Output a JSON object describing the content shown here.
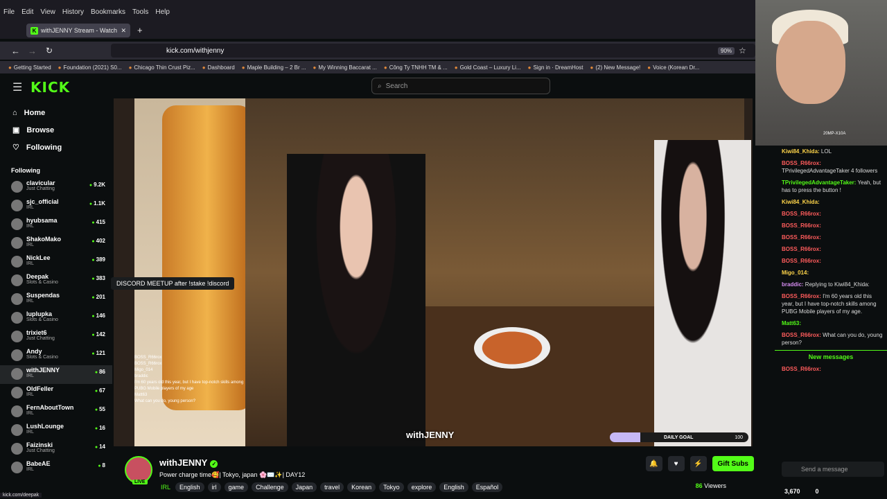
{
  "browser": {
    "menu": [
      "File",
      "Edit",
      "View",
      "History",
      "Bookmarks",
      "Tools",
      "Help"
    ],
    "tab_title": "withJENNY Stream - Watch",
    "url": "kick.com/withjenny",
    "zoom": "90%",
    "bookmarks": [
      "Getting Started",
      "Foundation (2021) S0...",
      "Chicago Thin Crust Piz...",
      "Dashboard",
      "Maple Building – 2 Br ...",
      "My Winning Baccarat ...",
      "Công Ty TNHH TM & ...",
      "Gold Coast – Luxury Li...",
      "Sign in · DreamHost",
      "(2) New Message!",
      "Voice (Korean Dr..."
    ],
    "status_url": "kick.com/deepak"
  },
  "header": {
    "logo": "KICK",
    "search_placeholder": "Search"
  },
  "nav": [
    {
      "label": "Home",
      "icon": "⌂"
    },
    {
      "label": "Browse",
      "icon": "▣"
    },
    {
      "label": "Following",
      "icon": "♡"
    }
  ],
  "following_heading": "Following",
  "channels": [
    {
      "name": "clavicular",
      "category": "Just Chatting",
      "viewers": "9.2K"
    },
    {
      "name": "sjc_official",
      "category": "IRL",
      "viewers": "1.1K"
    },
    {
      "name": "hyubsama",
      "category": "IRL",
      "viewers": "415"
    },
    {
      "name": "ShakoMako",
      "category": "IRL",
      "viewers": "402"
    },
    {
      "name": "NickLee",
      "category": "IRL",
      "viewers": "389"
    },
    {
      "name": "Deepak",
      "category": "Slots & Casino",
      "viewers": "383"
    },
    {
      "name": "Suspendas",
      "category": "IRL",
      "viewers": "201"
    },
    {
      "name": "luplupka",
      "category": "Slots & Casino",
      "viewers": "146"
    },
    {
      "name": "trixiet6",
      "category": "Just Chatting",
      "viewers": "142"
    },
    {
      "name": "Andy",
      "category": "Slots & Casino",
      "viewers": "121"
    },
    {
      "name": "withJENNY",
      "category": "IRL",
      "viewers": "86"
    },
    {
      "name": "OldFeller",
      "category": "IRL",
      "viewers": "67"
    },
    {
      "name": "FernAboutTown",
      "category": "IRL",
      "viewers": "55"
    },
    {
      "name": "LushLounge",
      "category": "IRL",
      "viewers": "16"
    },
    {
      "name": "Faizinski",
      "category": "Just Chatting",
      "viewers": "14"
    },
    {
      "name": "BabeAE",
      "category": "IRL",
      "viewers": "8"
    }
  ],
  "tooltip": "DISCORD MEETUP after !stake !discord",
  "video": {
    "watermark": "withJENNY",
    "goal_label": "DAILY GOAL",
    "goal_value": "100",
    "goal_progress": 0.22,
    "overlay_chat": [
      "BOSS_R66rox",
      "BOSS_R66rox",
      "Migo_014",
      "braddic",
      "I'm 60 years old this year, but I have top-notch skills among PUBG Mobile players of my age",
      "Matt63",
      "What can you do, young person?"
    ]
  },
  "webcam": {
    "label": "20MP-X10A"
  },
  "chat": {
    "messages": [
      {
        "user": "Kiwi84_Khida:",
        "text": "LOL",
        "color": "y"
      },
      {
        "user": "BOSS_R66rox:",
        "text": "TPrivilegedAdvantageTaker 4 followers",
        "color": "r"
      },
      {
        "user": "TPrivilegedAdvantageTaker:",
        "text": "Yeah, but has to press the button !",
        "color": "g"
      },
      {
        "user": "Kiwi84_Khida:",
        "text": "",
        "color": "y"
      },
      {
        "user": "BOSS_R66rox:",
        "text": "",
        "color": "r"
      },
      {
        "user": "BOSS_R66rox:",
        "text": "",
        "color": "r"
      },
      {
        "user": "BOSS_R66rox:",
        "text": "",
        "color": "r"
      },
      {
        "user": "BOSS_R66rox:",
        "text": "",
        "color": "r"
      },
      {
        "user": "BOSS_R66rox:",
        "text": "",
        "color": "r"
      },
      {
        "user": "Migo_014:",
        "text": "",
        "color": "y"
      },
      {
        "user": "braddic:",
        "text": "Replying to Kiwi84_Khida:",
        "color": "p"
      },
      {
        "user": "BOSS_R66rox:",
        "text": "I'm 60 years old this year, but I have top-notch skills among PUBG Mobile players of my age.",
        "color": "r"
      },
      {
        "user": "Matt63:",
        "text": "",
        "color": "g"
      },
      {
        "user": "BOSS_R66rox:",
        "text": "What can you do, young person?",
        "color": "r"
      }
    ],
    "new_messages": "New messages",
    "last": {
      "user": "BOSS_R66rox:",
      "text": ""
    },
    "input_placeholder": "Send a message",
    "points": "3,670",
    "count": "0"
  },
  "stream": {
    "name": "withJENNY",
    "live": "LIVE",
    "title": "Power charge time🥰| Tokyo, japan 🌸✉️✨| DAY12",
    "category": "IRL",
    "tags": [
      "English",
      "irl",
      "game",
      "Challenge",
      "Japan",
      "travel",
      "Korean",
      "Tokyo",
      "explore",
      "English",
      "Español"
    ],
    "viewers": "86",
    "viewers_label": "Viewers",
    "gift_label": "Gift Subs"
  }
}
